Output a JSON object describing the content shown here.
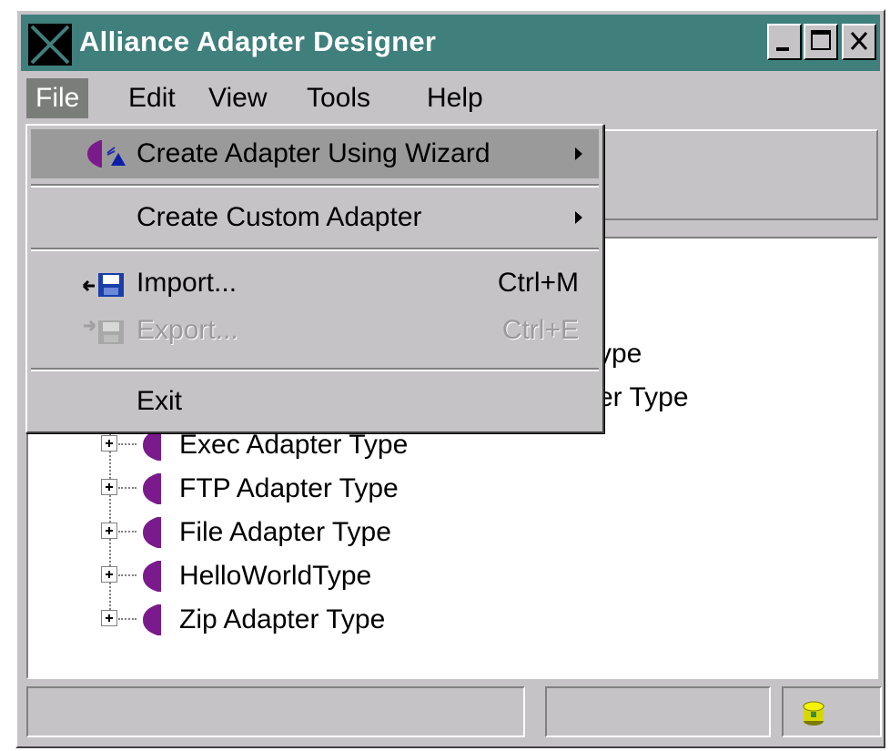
{
  "window": {
    "title": "Alliance Adapter Designer",
    "icon": "app-x-icon"
  },
  "title_buttons": [
    {
      "name": "minimize-button",
      "icon": "minimize-icon"
    },
    {
      "name": "maximize-button",
      "icon": "maximize-icon"
    },
    {
      "name": "close-button",
      "icon": "close-icon"
    }
  ],
  "menubar": {
    "file": "File",
    "edit": "Edit",
    "view": "View",
    "tools": "Tools",
    "help": "Help"
  },
  "file_menu": {
    "create_wizard": {
      "label": "Create Adapter Using Wizard",
      "icon": "wizard-adapter-icon",
      "submenu": true
    },
    "create_custom": {
      "label": "Create Custom Adapter",
      "submenu": true
    },
    "import": {
      "label": "Import...",
      "shortcut": "Ctrl+M",
      "icon": "import-disk-icon"
    },
    "export": {
      "label": "Export...",
      "shortcut": "Ctrl+E",
      "icon": "export-disk-icon",
      "disabled": true
    },
    "exit": {
      "label": "Exit"
    }
  },
  "tree": {
    "partial_rows": [
      "ype",
      "er Type"
    ],
    "items": [
      {
        "label": "Exec Adapter Type",
        "icon": "adapter-type-icon"
      },
      {
        "label": "FTP Adapter Type",
        "icon": "adapter-type-icon"
      },
      {
        "label": "File Adapter Type",
        "icon": "adapter-type-icon"
      },
      {
        "label": "HelloWorldType",
        "icon": "adapter-type-icon"
      },
      {
        "label": "Zip Adapter Type",
        "icon": "adapter-type-icon"
      }
    ]
  },
  "statusbar": {
    "icon": "database-icon"
  },
  "colors": {
    "titlebar": "#3f7f7c",
    "face": "#c6c3c6",
    "adapter_icon": "#7b1a8c",
    "menu_active": "#7b7d7b"
  }
}
